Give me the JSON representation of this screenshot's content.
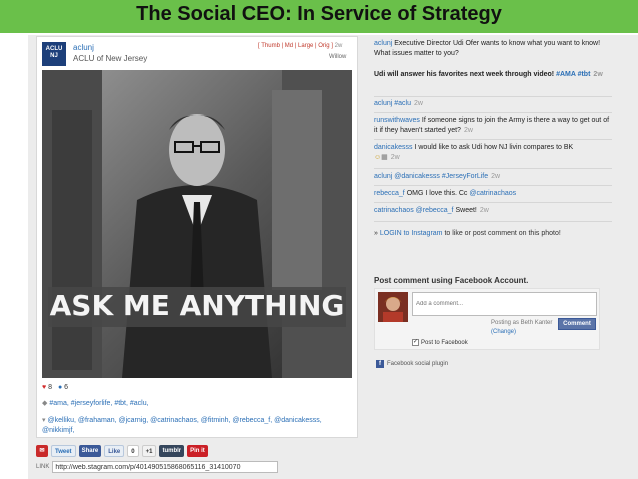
{
  "slide": {
    "title": "The Social CEO: In Service of Strategy"
  },
  "colors": {
    "banner": "#6ac04a",
    "link": "#2b6fb6",
    "facebook": "#3b5998",
    "heart": "#d12a2a"
  },
  "post": {
    "logo_text": "ACLU NJ",
    "username": "aclunj",
    "fullname": "ACLU of New Jersey",
    "sizes": "[ Thumb | Md | Large | Orig ]",
    "age": "2w",
    "filter": "Willow",
    "photo_caption": "ASK ME ANYTHING",
    "likes": "8",
    "comments_count": "6",
    "tags": "#ama, #jerseyforlife, #tbt, #aclu,",
    "mentions": "@kelliku, @frahaman, @jcarnig, @catrinachaos, @fitminh, @rebecca_f, @danicakesss, @nikkimjf,"
  },
  "share": {
    "tweet": "Tweet",
    "fb_share": "Share",
    "like": "Like",
    "like_count": "0",
    "gplus": "+1",
    "tumblr": "tumblr",
    "pinit": "Pin it",
    "link_label": "LINK",
    "link_value": "http://web.stagram.com/p/401490515868065116_31410070"
  },
  "comments": [
    {
      "user": "aclunj",
      "text": "Executive Director Udi Ofer wants to know what you want to know! What issues matter to you?",
      "age": ""
    },
    {
      "user": "",
      "text": "Udi will answer his favorites next week through video!",
      "tags": "#AMA #tbt",
      "age": "2w"
    },
    {
      "user": "aclunj",
      "text": "",
      "tags": "#aclu",
      "age": "2w"
    },
    {
      "user": "runswithwaves",
      "text": "If someone signs to join the Army is there a way to get out of it if they haven't started yet?",
      "age": "2w"
    },
    {
      "user": "danicakesss",
      "text": "I would like to ask Udi how NJ livin compares to BK",
      "age": "2w"
    },
    {
      "user": "aclunj",
      "text": "",
      "tags": "@danicakesss #JerseyForLife",
      "age": "2w"
    },
    {
      "user": "rebecca_f",
      "text": "OMG I love this. Cc",
      "tags": "@catrinachaos",
      "age": "2w"
    },
    {
      "user": "catrinachaos",
      "text": "Sweet!",
      "tags": "@rebecca_f",
      "age": "2w"
    }
  ],
  "login": {
    "prefix": "»",
    "link": "LOGIN to Instagram",
    "rest": "to like or post comment on this photo!"
  },
  "facebook": {
    "title": "Post comment using Facebook Account.",
    "placeholder": "Add a comment...",
    "posting_as": "Posting as Beth Kanter",
    "change": "(Change)",
    "comment_button": "Comment",
    "post_to_fb": "Post to Facebook",
    "plugin": "Facebook social plugin"
  }
}
